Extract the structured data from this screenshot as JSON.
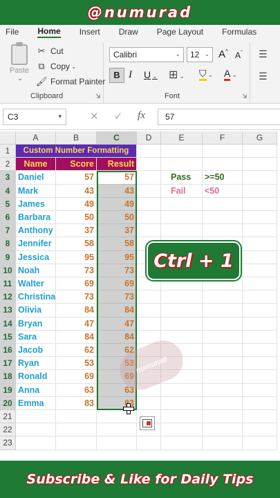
{
  "top_banner": {
    "text": "@numurad"
  },
  "bottom_banner": {
    "text": "Subscribe & Like for Daily Tips"
  },
  "overlay_badge": {
    "text": "Ctrl + 1"
  },
  "watermark": {
    "text": "numurad"
  },
  "ribbon": {
    "tabs": [
      "File",
      "Home",
      "Insert",
      "Draw",
      "Page Layout",
      "Formulas"
    ],
    "active_tab": "Home",
    "clipboard": {
      "paste": "Paste",
      "cut": "Cut",
      "copy": "Copy",
      "format_painter": "Format Painter",
      "group": "Clipboard"
    },
    "font": {
      "family": "Calibri",
      "size": "12",
      "bold": "B",
      "italic": "I",
      "underline": "U",
      "group": "Font",
      "grow": "A",
      "shrink": "A"
    }
  },
  "formula_bar": {
    "name_box": "C3",
    "value": "57",
    "cancel": "✕",
    "enter": "✓",
    "fx": "fx"
  },
  "sheet": {
    "columns": [
      "A",
      "B",
      "C",
      "D",
      "E",
      "F",
      "G"
    ],
    "selected_column": "C",
    "rows": [
      "1",
      "2",
      "3",
      "4",
      "5",
      "6",
      "7",
      "8",
      "9",
      "10",
      "11",
      "12",
      "13",
      "14",
      "15",
      "16",
      "17",
      "18",
      "19",
      "20",
      "21",
      "22",
      "23"
    ],
    "title": "Custom Number Formatting",
    "headers": {
      "name": "Name",
      "score": "Score",
      "result": "Result"
    },
    "records": [
      {
        "name": "Daniel",
        "score": "57",
        "result": "57"
      },
      {
        "name": "Mark",
        "score": "43",
        "result": "43"
      },
      {
        "name": "James",
        "score": "49",
        "result": "49"
      },
      {
        "name": "Barbara",
        "score": "50",
        "result": "50"
      },
      {
        "name": "Anthony",
        "score": "37",
        "result": "37"
      },
      {
        "name": "Jennifer",
        "score": "58",
        "result": "58"
      },
      {
        "name": "Jessica",
        "score": "95",
        "result": "95"
      },
      {
        "name": "Noah",
        "score": "73",
        "result": "73"
      },
      {
        "name": "Walter",
        "score": "69",
        "result": "69"
      },
      {
        "name": "Christina",
        "score": "73",
        "result": "73"
      },
      {
        "name": "Olivia",
        "score": "84",
        "result": "84"
      },
      {
        "name": "Bryan",
        "score": "47",
        "result": "47"
      },
      {
        "name": "Sara",
        "score": "84",
        "result": "84"
      },
      {
        "name": "Jacob",
        "score": "62",
        "result": "62"
      },
      {
        "name": "Ryan",
        "score": "53",
        "result": "53"
      },
      {
        "name": "Ronald",
        "score": "69",
        "result": "69"
      },
      {
        "name": "Anna",
        "score": "63",
        "result": "63"
      },
      {
        "name": "Emma",
        "score": "83",
        "result": "83"
      }
    ],
    "legend": [
      {
        "label": "Pass",
        "rule": ">=50",
        "color": "#2e6b1f"
      },
      {
        "label": "Fail",
        "rule": "<50",
        "color": "#e06a9a"
      }
    ],
    "colors": {
      "title_bg": "#5b2bb5",
      "title_text": "#ffd84a",
      "header_bg": "#a0105f",
      "header_text": "#ffd84a",
      "name": "#1f9fd0",
      "score": "#c8742a",
      "result": "#c8742a",
      "selection": "#d0d0d0",
      "accent": "#1e7a34"
    }
  }
}
